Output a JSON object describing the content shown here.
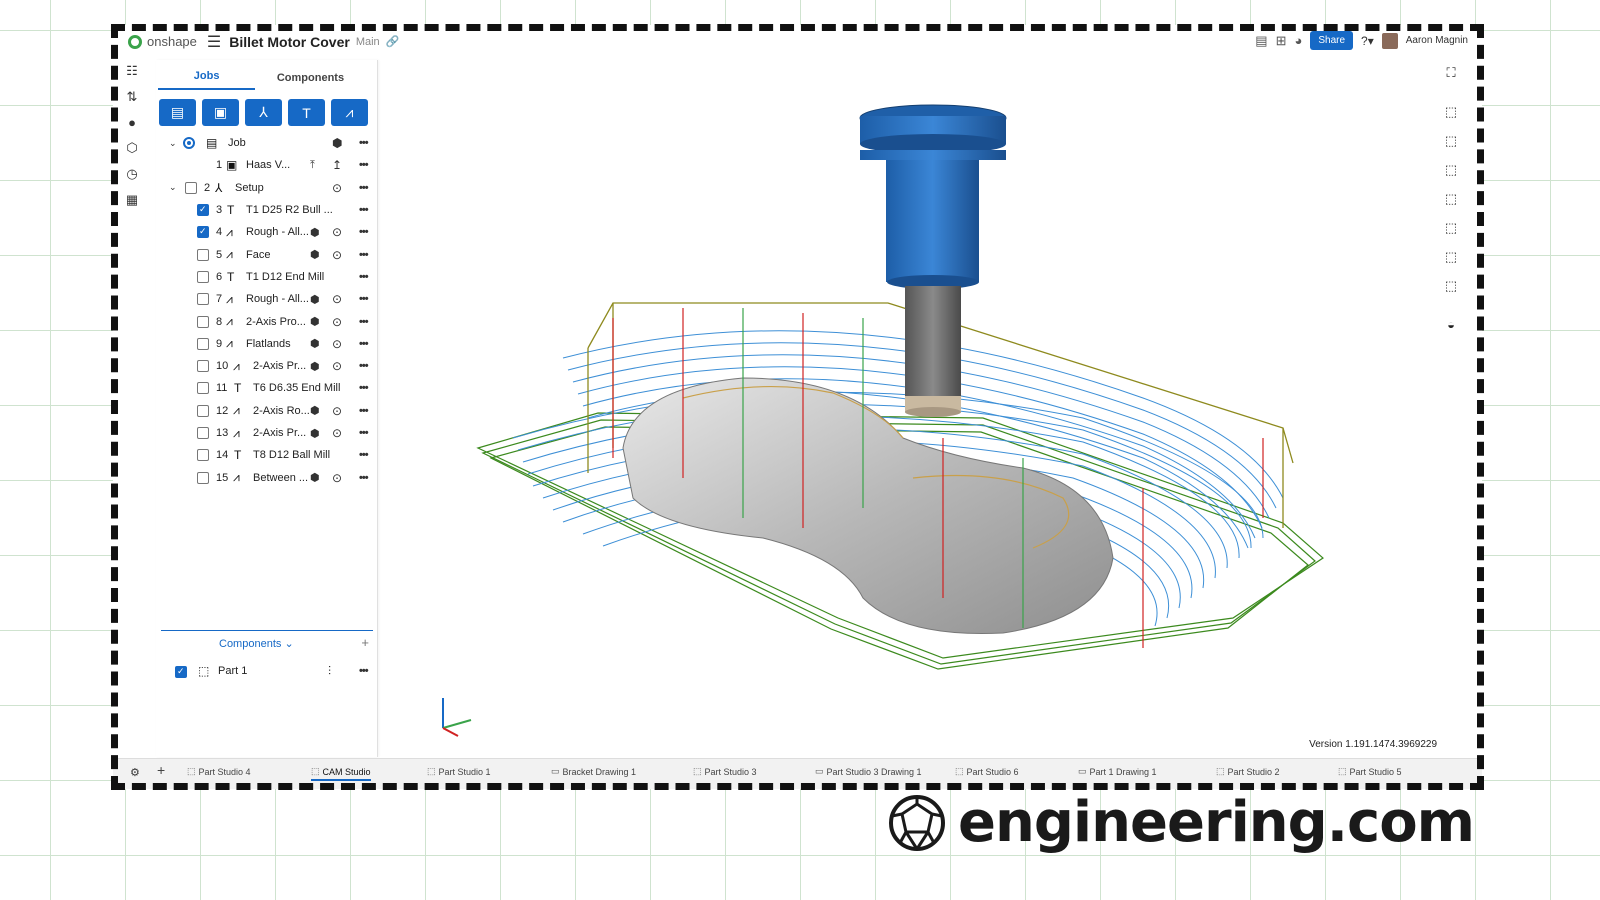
{
  "app": {
    "brand": "onshape",
    "document_title": "Billet Motor Cover",
    "branch": "Main",
    "share_label": "Share",
    "user_name": "Aaron Magnin"
  },
  "panel": {
    "tabs": [
      "Jobs",
      "Components"
    ],
    "tree": [
      {
        "num": "",
        "label": "Job"
      },
      {
        "num": "1",
        "label": "Haas V..."
      },
      {
        "num": "2",
        "label": "Setup"
      },
      {
        "num": "3",
        "label": "T1 D25 R2 Bull ..."
      },
      {
        "num": "4",
        "label": "Rough - All..."
      },
      {
        "num": "5",
        "label": "Face"
      },
      {
        "num": "6",
        "label": "T1 D12 End Mill"
      },
      {
        "num": "7",
        "label": "Rough - All..."
      },
      {
        "num": "8",
        "label": "2-Axis Pro..."
      },
      {
        "num": "9",
        "label": "Flatlands"
      },
      {
        "num": "10",
        "label": "2-Axis Pr..."
      },
      {
        "num": "11",
        "label": "T6 D6.35 End Mill"
      },
      {
        "num": "12",
        "label": "2-Axis Ro..."
      },
      {
        "num": "13",
        "label": "2-Axis Pr..."
      },
      {
        "num": "14",
        "label": "T8 D12 Ball Mill"
      },
      {
        "num": "15",
        "label": "Between ..."
      }
    ],
    "components_header": "Components",
    "part_label": "Part 1"
  },
  "viewport": {
    "version": "Version 1.191.1474.3969229"
  },
  "bottom_tabs": [
    "Part Studio 4",
    "CAM Studio",
    "Part Studio 1",
    "Bracket Drawing 1",
    "Part Studio 3",
    "Part Studio 3 Drawing 1",
    "Part Studio 6",
    "Part 1 Drawing 1",
    "Part Studio 2",
    "Part Studio 5"
  ],
  "watermark": {
    "text": "engineering.com"
  },
  "colors": {
    "accent": "#1669c6",
    "brand_green": "#3aa34a",
    "tool_blue": "#2a6fb8",
    "toolpath_green": "#3c8a1e",
    "toolpath_blue": "#3d8fd6"
  },
  "icons": {
    "rail": [
      "feature-list-icon",
      "variables-icon",
      "comments-icon",
      "parts-icon",
      "history-icon",
      "notes-icon"
    ]
  }
}
